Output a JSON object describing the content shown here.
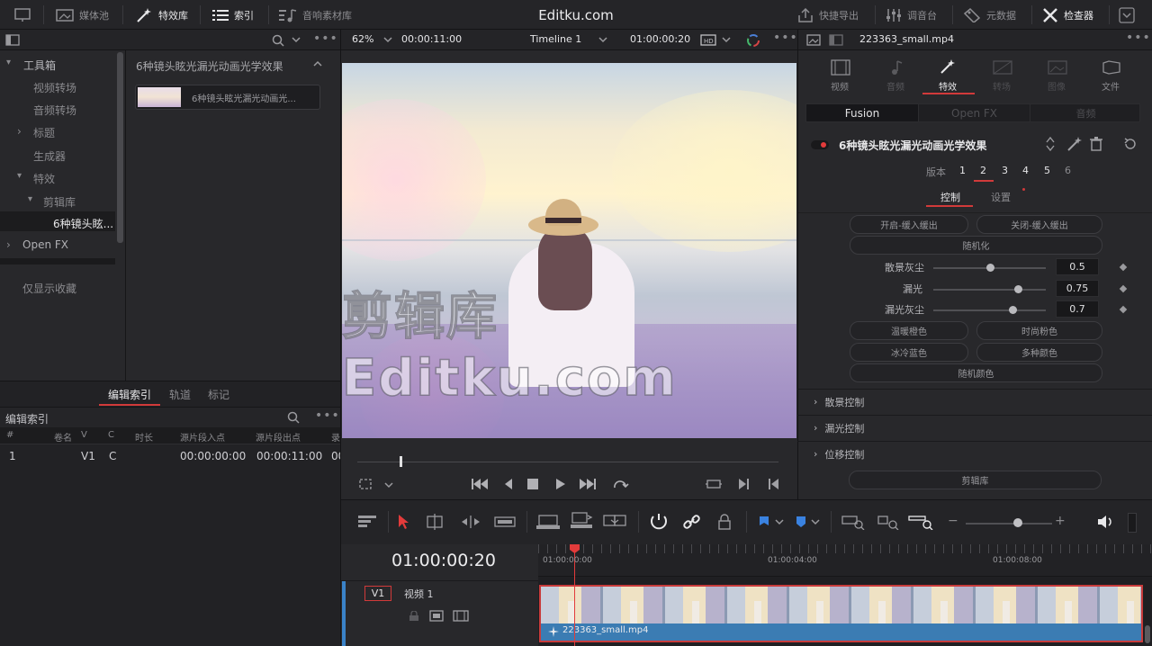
{
  "topbar": {
    "media_pool": "媒体池",
    "effects_library": "特效库",
    "index": "索引",
    "sound_library": "音响素材库",
    "app_title": "Editku.com",
    "quick_export": "快捷导出",
    "mixer": "调音台",
    "metadata": "元数据",
    "inspector": "检查器"
  },
  "left_panel": {
    "tree": [
      {
        "label": "工具箱",
        "arrow": "▾"
      },
      {
        "label": "视频转场",
        "arrow": ""
      },
      {
        "label": "音频转场",
        "arrow": ""
      },
      {
        "label": "标题",
        "arrow": "›"
      },
      {
        "label": "生成器",
        "arrow": ""
      },
      {
        "label": "特效",
        "arrow": "▾"
      },
      {
        "label": "剪辑库",
        "arrow": "▾"
      },
      {
        "label": "6种镜头眩...",
        "arrow": ""
      },
      {
        "label": "Open FX",
        "arrow": "›"
      }
    ],
    "favorites_only": "仅显示收藏",
    "effects_header": "6种镜头眩光漏光动画光学效果",
    "effect_item": "6种镜头眩光漏光动画光..."
  },
  "index_panel": {
    "tabs": [
      "编辑索引",
      "轨道",
      "标记"
    ],
    "title": "编辑索引",
    "columns": [
      "#",
      "卷名",
      "V",
      "C",
      "时长",
      "源片段入点",
      "源片段出点",
      "录"
    ],
    "rows": [
      {
        "num": "1",
        "reel": "",
        "v": "V1",
        "c": "C",
        "dur": "",
        "in": "00:00:00:00",
        "out": "00:00:11:00",
        "rec": "00"
      }
    ]
  },
  "viewer": {
    "zoom": "62%",
    "timecode_left": "00:00:11:00",
    "timeline_name": "Timeline 1",
    "timecode_right": "01:00:00:20",
    "watermark": "剪辑库 Editku.com",
    "playhead_progress": 0.1
  },
  "inspector": {
    "filename": "223363_small.mp4",
    "tabs": [
      "视频",
      "音频",
      "特效",
      "转场",
      "图像",
      "文件"
    ],
    "subtabs": [
      "Fusion",
      "Open FX",
      "音频"
    ],
    "effect_name": "6种镜头眩光漏光动画光学效果",
    "version_label": "版本",
    "versions": [
      "1",
      "2",
      "3",
      "4",
      "5",
      "6"
    ],
    "control_tabs": [
      "控制",
      "设置"
    ],
    "buttons_row1": [
      "开启-缓入缓出",
      "关闭-缓入缓出"
    ],
    "random_btn": "随机化",
    "params": [
      {
        "label": "散景灰尘",
        "value": "0.5",
        "pos": 0.5
      },
      {
        "label": "漏光",
        "value": "0.75",
        "pos": 0.75
      },
      {
        "label": "漏光灰尘",
        "value": "0.7",
        "pos": 0.7
      }
    ],
    "color_buttons": [
      "温暖橙色",
      "时尚粉色",
      "冰冷蓝色",
      "多种颜色"
    ],
    "random_color": "随机颜色",
    "sections": [
      "散景控制",
      "漏光控制",
      "位移控制"
    ],
    "library_btn": "剪辑库"
  },
  "timeline": {
    "timecode": "01:00:00:20",
    "ruler": [
      "01:00:00:00",
      "01:00:04:00",
      "01:00:08:00"
    ],
    "track_id": "V1",
    "track_name": "视频 1",
    "clip_name": "223363_small.mp4"
  }
}
